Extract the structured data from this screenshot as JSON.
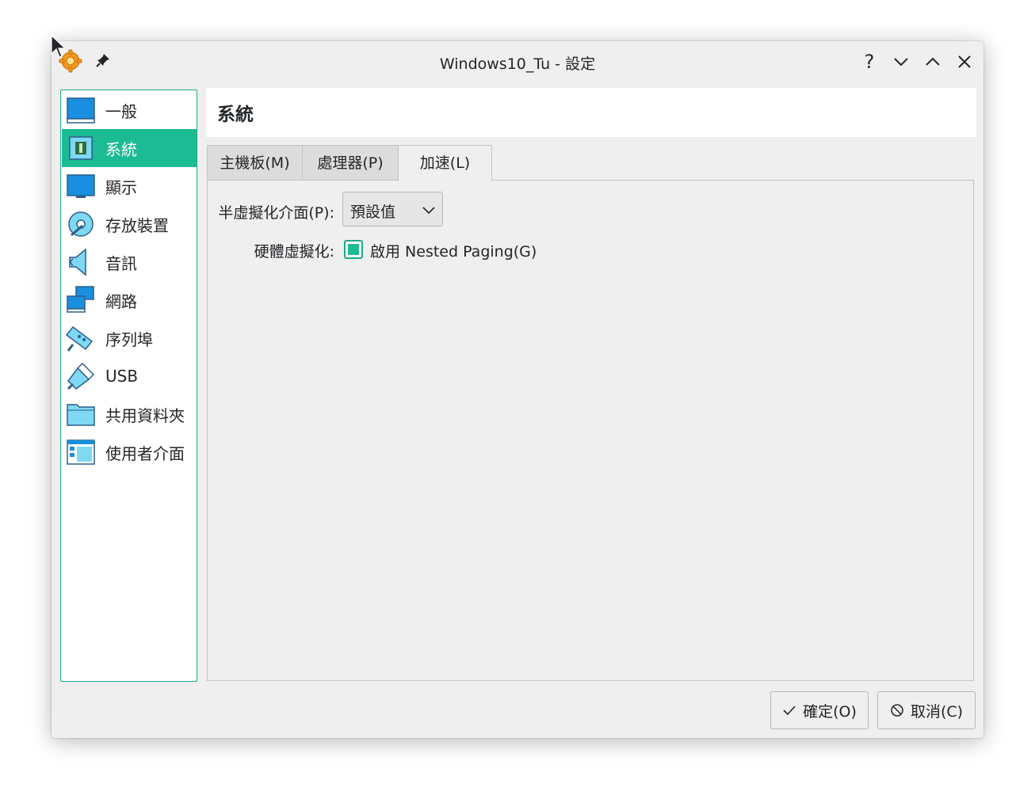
{
  "window": {
    "title": "Windows10_Tu - 設定",
    "controls": [
      "help-icon",
      "minimize-icon",
      "maximize-icon",
      "close-icon"
    ]
  },
  "sidebar": {
    "items": [
      {
        "label": "一般",
        "icon": "general-icon"
      },
      {
        "label": "系統",
        "icon": "system-chip-icon"
      },
      {
        "label": "顯示",
        "icon": "display-monitor-icon"
      },
      {
        "label": "存放裝置",
        "icon": "storage-disk-icon"
      },
      {
        "label": "音訊",
        "icon": "audio-speaker-icon"
      },
      {
        "label": "網路",
        "icon": "network-icon"
      },
      {
        "label": "序列埠",
        "icon": "serial-port-icon"
      },
      {
        "label": "USB",
        "icon": "usb-icon"
      },
      {
        "label": "共用資料夾",
        "icon": "shared-folder-icon"
      },
      {
        "label": "使用者介面",
        "icon": "user-interface-icon"
      }
    ],
    "selected": "系統"
  },
  "header": {
    "title": "系統"
  },
  "tabs": [
    {
      "label": "主機板(M)"
    },
    {
      "label": "處理器(P)"
    },
    {
      "label": "加速(L)"
    }
  ],
  "active_tab": "加速(L)",
  "acceleration": {
    "paravirt_label": "半虛擬化介面(P):",
    "paravirt_value": "預設值",
    "hw_virt_label": "硬體虛擬化:",
    "nested_paging_label": "啟用 Nested Paging(G)",
    "nested_paging_checked": true
  },
  "buttons": {
    "ok_label": "確定(O)",
    "cancel_label": "取消(C)"
  },
  "colors": {
    "accent": "#1dbb93",
    "accent_border": "#1fa88a",
    "window_bg": "#efefef",
    "text": "#232629"
  }
}
